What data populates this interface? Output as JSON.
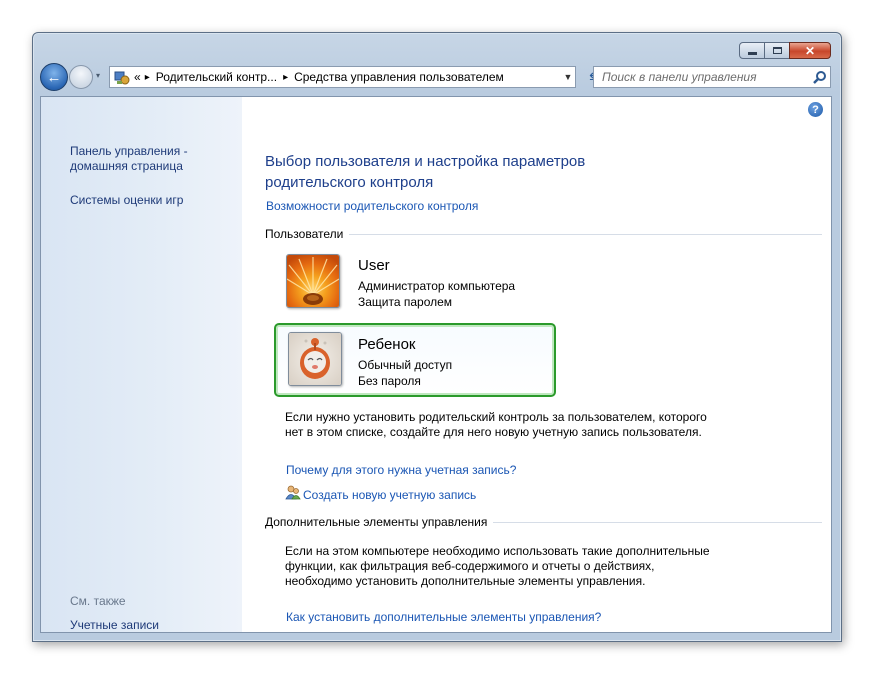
{
  "window": {
    "caption_buttons": [
      "minimize",
      "maximize",
      "close"
    ]
  },
  "address": {
    "segments": [
      "Родительский контр...",
      "Средства управления пользователем"
    ],
    "chevron": "«",
    "separator": "▸"
  },
  "search": {
    "placeholder": "Поиск в панели управления"
  },
  "sidebar": {
    "home_link": "Панель управления - домашняя страница",
    "games_link": "Системы оценки игр",
    "see_also": "См. также",
    "accounts_link": "Учетные записи пользователей"
  },
  "main": {
    "title": "Выбор пользователя и настройка параметров родительского контроля",
    "features_link": "Возможности родительского контроля",
    "users_section": "Пользователи",
    "users": [
      {
        "name": "User",
        "role": "Администратор компьютера",
        "password": "Защита паролем"
      },
      {
        "name": "Ребенок",
        "role": "Обычный доступ",
        "password": "Без пароля"
      }
    ],
    "info_text": "Если нужно установить родительский контроль за пользователем, которого нет в этом списке, создайте для него новую учетную запись пользователя.",
    "why_link": "Почему для этого нужна учетная запись?",
    "create_link": "Создать новую учетную запись",
    "extra_section": "Дополнительные элементы управления",
    "extra_text": "Если на этом компьютере необходимо использовать такие дополнительные функции, как фильтрация веб-содержимого и отчеты о действиях, необходимо установить дополнительные элементы управления.",
    "howto_link": "Как установить дополнительные элементы управления?"
  },
  "icons": {
    "back": "back-arrow-icon",
    "forward": "forward-arrow-icon",
    "refresh": "refresh-icon",
    "search": "search-icon",
    "help": "help-icon",
    "create_account": "add-user-icon"
  },
  "colors": {
    "link": "#1a56b4",
    "title": "#1e3f8b",
    "selection_border": "#2b9a2b",
    "close_button": "#c8462b"
  }
}
